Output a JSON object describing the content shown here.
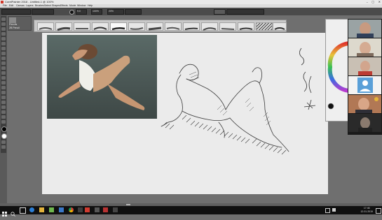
{
  "window": {
    "title": "CorelPainter 2018 - Untitled-1 @ 100%",
    "controls": [
      "–",
      "▢",
      "✕"
    ]
  },
  "menu": [
    "File",
    "Edit",
    "Canvas",
    "Layers",
    "Brushes",
    "Select",
    "Shapes",
    "Effects",
    "Movie",
    "Window",
    "Help"
  ],
  "property_bar": {
    "size_value": "9.0",
    "opacity_value": "100%",
    "grain_value": "20%"
  },
  "brush_selector": {
    "category": "Pencils",
    "variant": "2B Pencil"
  },
  "taskbar": {
    "time": "17:46",
    "date": "12.01.2019"
  },
  "colors": {
    "accent": "#cf3a2f",
    "canvas": "#ebebeb",
    "taskbar": "#101010"
  },
  "icons": [
    "window-app-icon",
    "search-icon",
    "task-view-icon",
    "edge-icon",
    "explorer-icon",
    "store-icon",
    "chrome-icon",
    "painter-icon",
    "settings-icon",
    "media-icon",
    "network-icon",
    "volume-icon",
    "notification-icon"
  ]
}
